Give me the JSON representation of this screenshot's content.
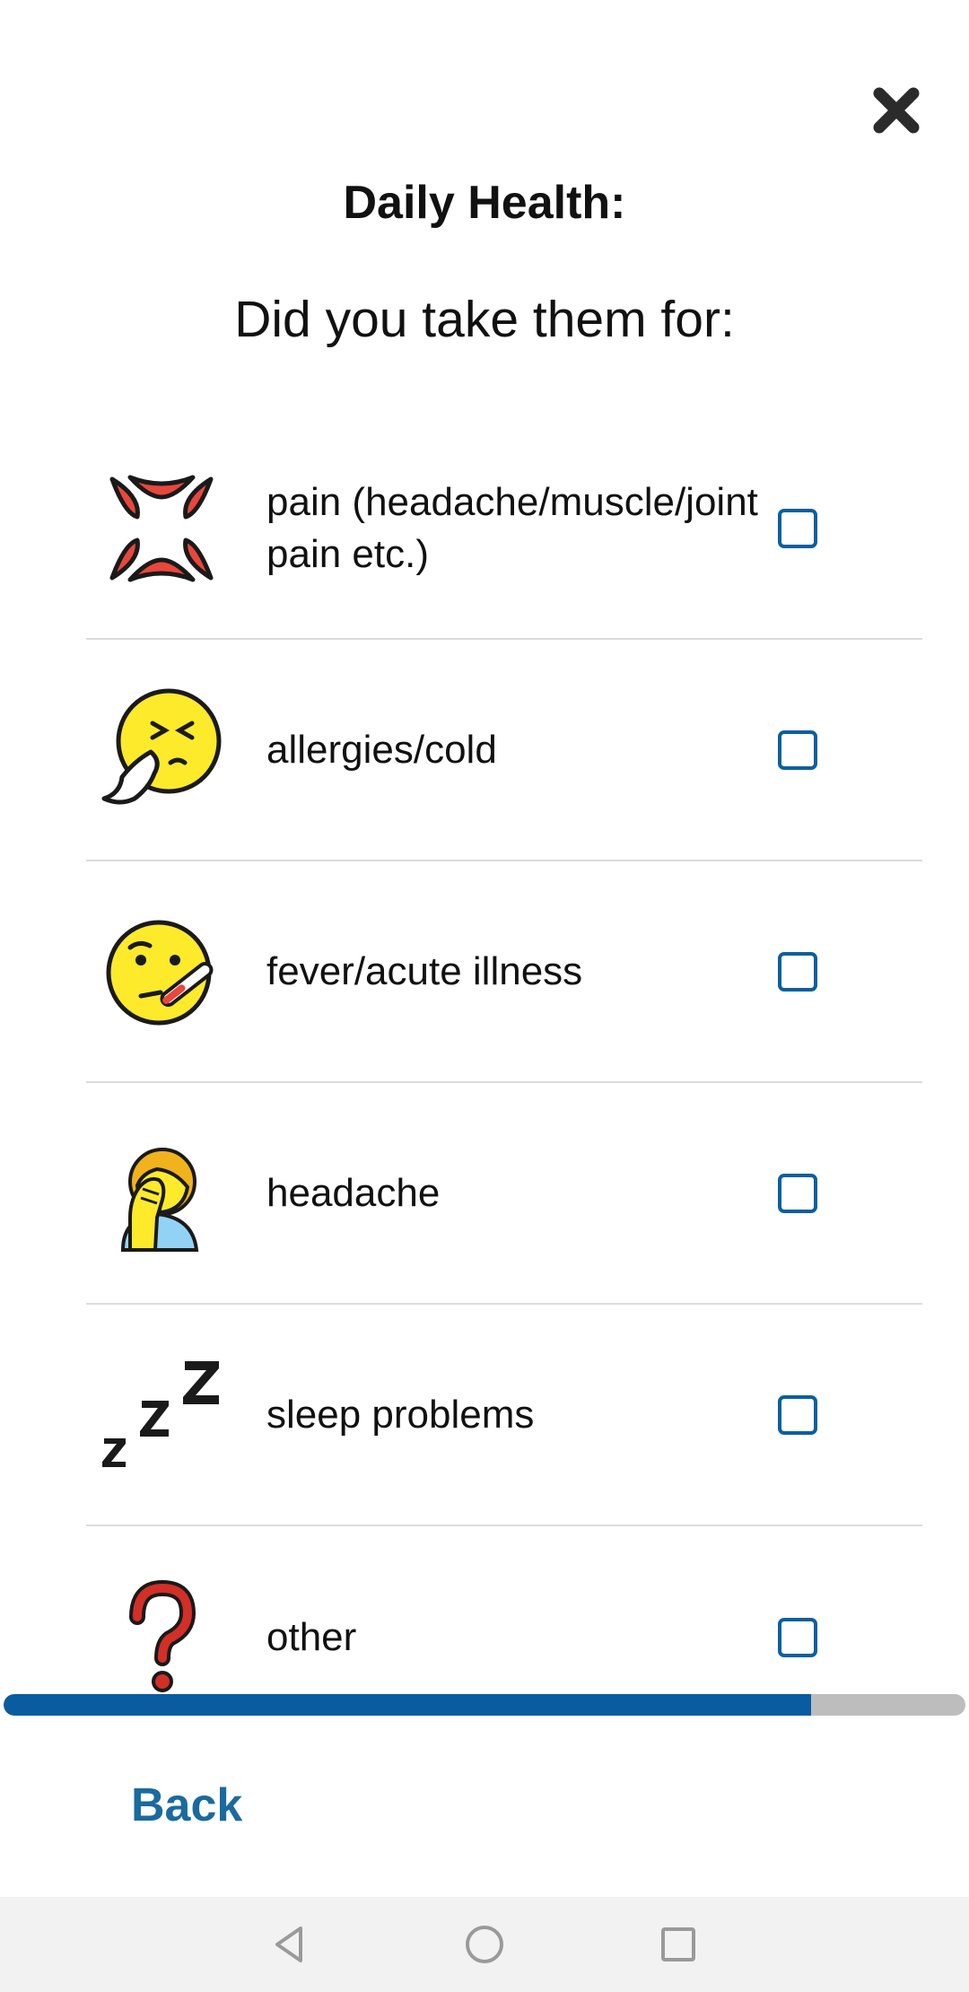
{
  "header": {
    "title": "Daily Health:",
    "question": "Did you take them for:"
  },
  "options": [
    {
      "label": "pain (headache/muscle/joint pain etc.)",
      "icon": "anger-symbol-icon",
      "checked": false
    },
    {
      "label": "allergies/cold",
      "icon": "sneezing-face-icon",
      "checked": false
    },
    {
      "label": "fever/acute illness",
      "icon": "face-with-thermometer-icon",
      "checked": false
    },
    {
      "label": "headache",
      "icon": "person-facepalming-icon",
      "checked": false
    },
    {
      "label": "sleep problems",
      "icon": "zzz-icon",
      "checked": false
    },
    {
      "label": "other",
      "icon": "question-mark-icon",
      "checked": false
    }
  ],
  "progress": {
    "fraction": 0.84
  },
  "footer": {
    "back_label": "Back"
  },
  "colors": {
    "accent": "#0a5ca0",
    "checkbox_border": "#0a5fa0",
    "back_text": "#1a6a9f",
    "progress_track": "#bdbdbd"
  }
}
